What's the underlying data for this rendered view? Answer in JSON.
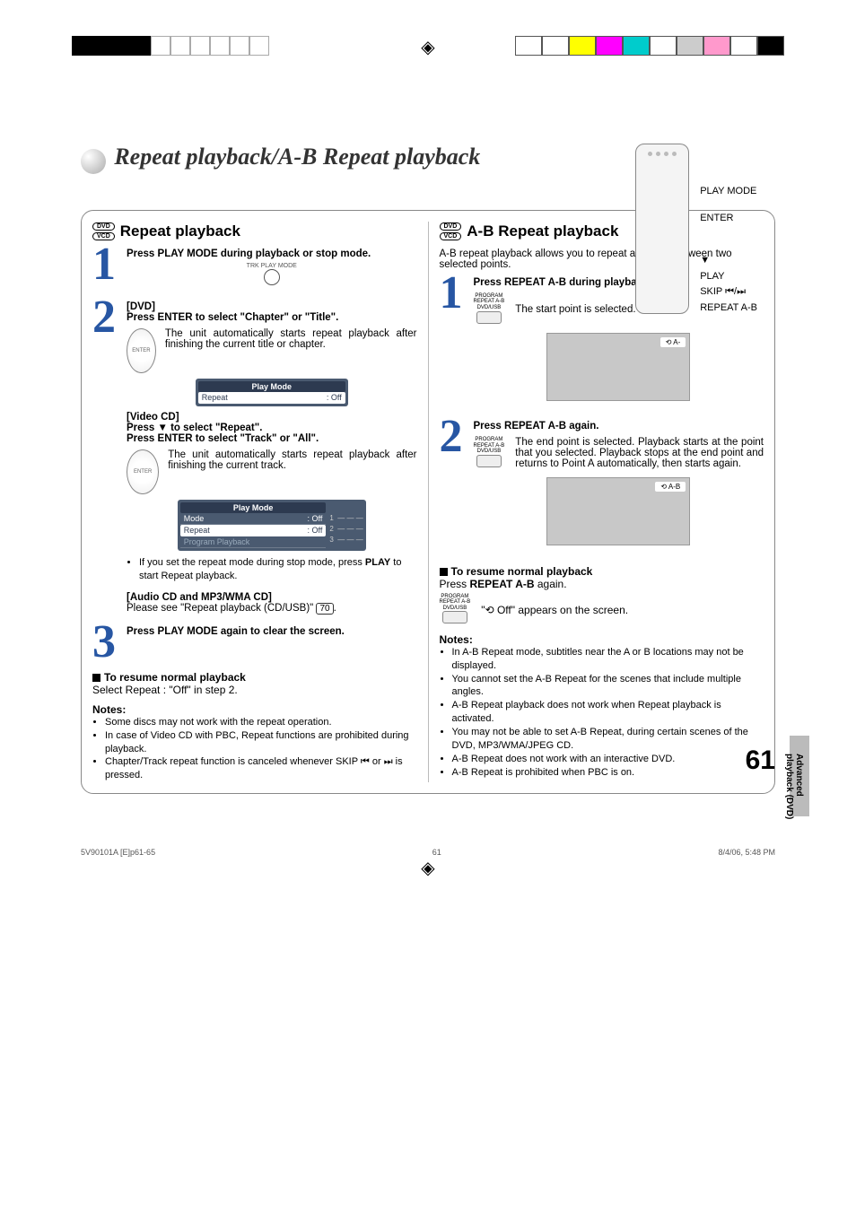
{
  "page_title": "Repeat playback/A-B Repeat playback",
  "remote_labels": {
    "l1": "PLAY MODE",
    "l2": "ENTER",
    "l3": "▼",
    "l4": "PLAY",
    "l5": "SKIP ⏮/⏭",
    "l6": "REPEAT A-B"
  },
  "left": {
    "title": "Repeat playback",
    "badge1": "DVD",
    "badge2": "VCD",
    "step1": {
      "instr": "Press PLAY MODE during playback or stop mode.",
      "icon_label": "TRK\nPLAY MODE"
    },
    "step2": {
      "dvd_label": "[DVD]",
      "dvd_instr": "Press ENTER to select \"Chapter\" or \"Title\".",
      "dvd_body": "The unit automatically starts repeat playback after finishing the current title or chapter.",
      "osd1": {
        "title": "Play Mode",
        "row1k": "Repeat",
        "row1v": ": Off"
      },
      "vcd_label": "[Video CD]",
      "vcd_line1": "Press ▼ to select \"Repeat\".",
      "vcd_line2": "Press ENTER to select \"Track\" or \"All\".",
      "vcd_body": "The unit automatically starts repeat playback after finishing the current track.",
      "osd2": {
        "title": "Play Mode",
        "r1k": "Mode",
        "r1v": ": Off",
        "r2k": "Repeat",
        "r2v": ": Off",
        "r3": "Program Playback",
        "side": [
          "1",
          "2",
          "3"
        ],
        "dash": "— — —"
      },
      "bullet": "If you set the repeat mode during stop mode, press ",
      "bullet_bold": "PLAY",
      "bullet_tail": " to start Repeat playback.",
      "audio_label": "[Audio CD and MP3/WMA CD]",
      "audio_body": "Please see \"Repeat playback (CD/USB)\" ",
      "audio_ref": "70",
      "audio_tail": "."
    },
    "step3": {
      "instr": "Press PLAY MODE again to clear the screen."
    },
    "resume_h": "To resume normal playback",
    "resume_b": "Select Repeat : \"Off\" in step 2.",
    "notes_h": "Notes:",
    "notes": [
      "Some discs may not work with the repeat operation.",
      "In case of Video CD with PBC, Repeat functions are prohibited during playback.",
      "Chapter/Track repeat function is canceled whenever SKIP ⏮ or ⏭ is pressed."
    ]
  },
  "right": {
    "title": "A-B Repeat playback",
    "badge1": "DVD",
    "badge2": "VCD",
    "intro": "A-B repeat playback allows you to repeat a section between two selected points.",
    "step1": {
      "instr": "Press REPEAT A-B during playback.",
      "icon_label": "PROGRAM\nREPEAT A-B\nDVD/USB",
      "body": "The start point is selected.",
      "tag": "⟲ A-"
    },
    "step2": {
      "instr": "Press REPEAT A-B again.",
      "body": "The end point is selected. Playback starts at the point that you selected. Playback stops at the end point and returns to Point A automatically, then starts again.",
      "tag": "⟲ A-B"
    },
    "resume_h": "To resume normal playback",
    "resume_b1": "Press ",
    "resume_b1_bold": "REPEAT A-B",
    "resume_b1_tail": " again.",
    "off_msg_pre": "\"",
    "off_msg_icon": "⟲ Off",
    "off_msg_post": "\" appears on the screen.",
    "notes_h": "Notes:",
    "notes": [
      "In A-B Repeat mode, subtitles near the A or B locations may not be displayed.",
      "You cannot set the A-B Repeat for the scenes that include multiple angles.",
      "A-B Repeat playback does not work when Repeat playback is activated.",
      "You may not be able to set A-B Repeat, during certain scenes of the DVD, MP3/WMA/JPEG CD.",
      "A-B Repeat does not work with an interactive DVD.",
      "A-B Repeat is prohibited when PBC is on."
    ]
  },
  "side_tab": "Advanced playback (DVD)",
  "page_number": "61",
  "footer": {
    "left": "5V90101A [E]p61-65",
    "center": "61",
    "right": "8/4/06, 5:48 PM"
  },
  "colors": [
    "#ffff00",
    "#ff00ff",
    "#00cccc",
    "#cccccc",
    "#ff0000",
    "#00aa00",
    "#0000cc",
    "#000000"
  ]
}
